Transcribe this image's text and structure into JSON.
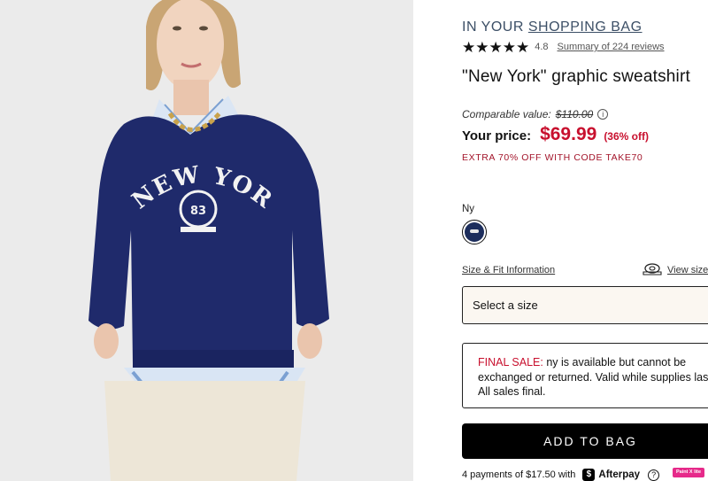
{
  "product_image": {
    "alt": "Model wearing navy NEW YORK graphic sweatshirt"
  },
  "header": {
    "in_your_prefix": "IN YOUR",
    "shopping_bag_link": "SHOPPING BAG"
  },
  "rating": {
    "stars_glyphs": "★★★★★",
    "value": "4.8",
    "reviews_link": "Summary of 224 reviews"
  },
  "product": {
    "title": "\"New York\" graphic sweatshirt"
  },
  "pricing": {
    "comparable_label": "Comparable value:",
    "comparable_value": "$110.00",
    "info_icon_glyph": "i",
    "your_price_label": "Your price:",
    "your_price": "$69.99",
    "discount": "(36% off)",
    "promo": "EXTRA 70% OFF WITH CODE TAKE70",
    "accent_color": "#c8102e"
  },
  "color": {
    "selected_name": "Ny",
    "swatch_color": "#1c2d5c"
  },
  "size": {
    "size_fit_link": "Size & Fit Information",
    "view_size_link": "View size",
    "select_placeholder": "Select a size"
  },
  "final_sale": {
    "label": "FINAL SALE:",
    "text": " ny is available but cannot be exchanged or returned. Valid while supplies last. All sales final."
  },
  "cta": {
    "add_to_bag": "ADD TO BAG"
  },
  "afterpay": {
    "text": "4 payments of $17.50 with",
    "logo_glyph": "$",
    "brand": "Afterpay",
    "help_glyph": "?"
  },
  "extension_badge": {
    "label": "Paint X lite"
  }
}
